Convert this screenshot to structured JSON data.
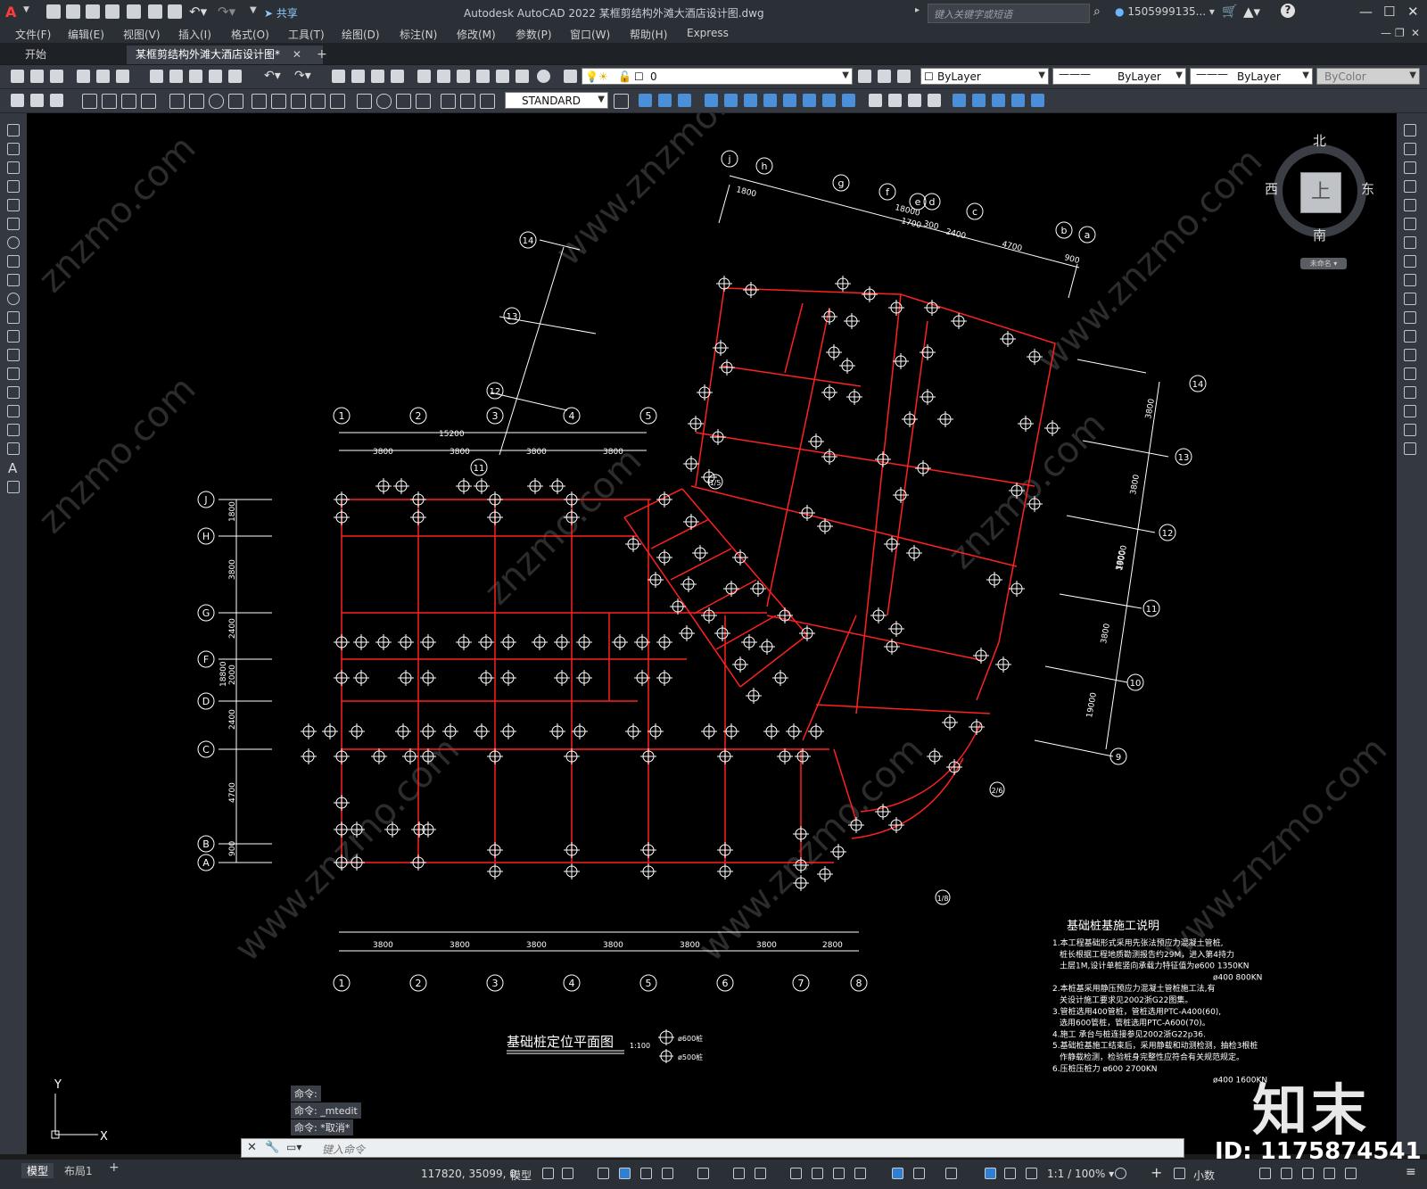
{
  "app": {
    "title": "Autodesk AutoCAD 2022    某框剪结构外滩大酒店设计图.dwg",
    "share_label": "共享",
    "search_placeholder": "键入关键字或短语",
    "user": "1505999135...",
    "logo_letter": "A"
  },
  "menu": [
    "文件(F)",
    "编辑(E)",
    "视图(V)",
    "插入(I)",
    "格式(O)",
    "工具(T)",
    "绘图(D)",
    "标注(N)",
    "修改(M)",
    "参数(P)",
    "窗口(W)",
    "帮助(H)",
    "Express"
  ],
  "tabs": {
    "start": "开始",
    "doc": "某框剪结构外滩大酒店设计图*",
    "add": "+"
  },
  "toolbar": {
    "layer_value": "0",
    "color": "ByLayer",
    "linetype": "ByLayer",
    "lineweight": "ByLayer",
    "plotstyle": "ByColor",
    "dimstyle": "STANDARD"
  },
  "viewcube": {
    "north": "北",
    "south": "南",
    "east": "东",
    "west": "西",
    "top": "上",
    "ucs": "未命名"
  },
  "drawing": {
    "grid_top_numbers": [
      "①",
      "②",
      "③",
      "④",
      "⑤"
    ],
    "grid_bottom_numbers": [
      "①",
      "②",
      "③",
      "④",
      "⑤",
      "⑥",
      "⑦",
      "⑧"
    ],
    "grid_letters": [
      "J",
      "H",
      "G",
      "F",
      "D",
      "C",
      "B",
      "A"
    ],
    "grid_top_letters": [
      "j",
      "h",
      "g",
      "f",
      "e",
      "d",
      "c",
      "b",
      "a"
    ],
    "grid_right_numbers": [
      "14",
      "13",
      "12",
      "11",
      "10",
      "9"
    ],
    "grid_rot_numbers": [
      "14",
      "13",
      "12",
      "11"
    ],
    "dims_top": [
      "15200",
      "3800",
      "3800",
      "3800",
      "3800"
    ],
    "dims_bottom": [
      "3800",
      "3800",
      "3800",
      "3800",
      "3800",
      "3800",
      "2800"
    ],
    "dims_left": [
      "1800",
      "3800",
      "2400",
      "2000",
      "2400",
      "4700",
      "900",
      "18800"
    ],
    "dims_slant_top": [
      "1800",
      "18000",
      "1700",
      "300",
      "2400",
      "4700",
      "900"
    ],
    "dims_right": [
      "3800",
      "3800",
      "3800",
      "3800",
      "19000"
    ],
    "plan_title": "基础桩定位平面图",
    "plan_scale": "1:100",
    "legend": [
      "ø600桩",
      "ø500桩"
    ],
    "notes_title": "基础桩基施工说明",
    "notes": [
      "1.本工程基础形式采用先张法预应力混凝土管桩,",
      "桩长根据工程地质勘测报告约29M，进入第4持力",
      "土层1M,设计单桩竖向承载力特征值为ø600 1350KN",
      "ø400 800KN",
      "2.本桩基采用静压预应力混凝土管桩施工法,有",
      "关设计施工要求见2002浙G22图集。",
      "3.管桩选用400管桩，管桩选用PTC-A400(60),",
      "选用600管桩，管桩选用PTC-A600(70)。",
      "4.施工 承台与桩连接参见2002浙G22p36.",
      "5.基础桩基施工结束后，采用静载和动测检测，抽检3根桩",
      "作静载检测，检验桩身完整性应符合有关规范规定。",
      "6.压桩压桩力 ø600 2700KN",
      "ø400 1600KN"
    ]
  },
  "command": {
    "history": [
      "命令:",
      "命令: _mtedit",
      "命令: *取消*"
    ],
    "placeholder": "键入命令"
  },
  "status": {
    "tab_model": "模型",
    "tab_layout": "布局1",
    "coords": "117820, 35099, 0",
    "space": "模型",
    "scale": "1:1 / 100%",
    "units": "小数"
  },
  "watermark": {
    "logo": "知末",
    "id": "ID: 1175874541"
  },
  "colors": {
    "beam": "#ff2020",
    "grid": "#ffffff",
    "pile": "#ffffff"
  }
}
